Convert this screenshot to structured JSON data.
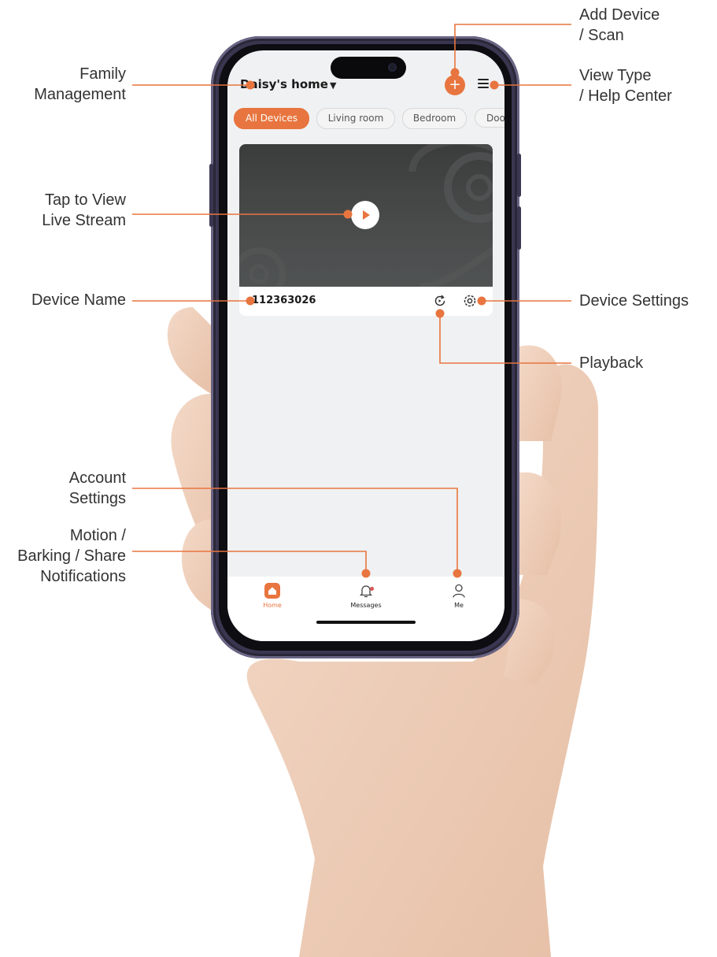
{
  "app": {
    "home_title": "Daisy's home",
    "tabs": [
      {
        "label": "All Devices",
        "active": true
      },
      {
        "label": "Living room",
        "active": false
      },
      {
        "label": "Bedroom",
        "active": false
      },
      {
        "label": "Doo",
        "active": false
      }
    ],
    "device": {
      "name": "112363026"
    },
    "nav": [
      {
        "label": "Home",
        "active": true
      },
      {
        "label": "Messages",
        "active": false
      },
      {
        "label": "Me",
        "active": false
      }
    ],
    "add_symbol": "+"
  },
  "callouts": {
    "family_management": "Family\nManagement",
    "add_device": "Add Device\n/ Scan",
    "view_type": "View Type\n/ Help Center",
    "tap_to_view": "Tap to View\nLive Stream",
    "device_name": "Device Name",
    "device_settings": "Device Settings",
    "playback": "Playback",
    "account_settings": "Account\nSettings",
    "notifications": "Motion /\nBarking / Share\nNotifications"
  },
  "colors": {
    "accent": "#e8753f",
    "callout_line": "#e8753f",
    "label_text": "#333333"
  }
}
